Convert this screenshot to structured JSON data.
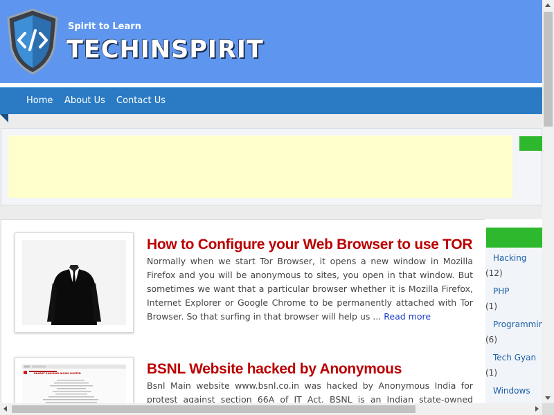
{
  "header": {
    "tagline": "Spirit to Learn",
    "brand": "TECHINSPIRIT",
    "logo_icon": "code-shield-icon",
    "bg_color": "#5e96ef"
  },
  "nav": {
    "items": [
      {
        "label": "Home"
      },
      {
        "label": "About Us"
      },
      {
        "label": "Contact Us"
      }
    ],
    "bg_color": "#2b7bc4"
  },
  "posts": [
    {
      "title": "How to Configure your Web Browser to use TOR",
      "excerpt": "Normally when we start Tor Browser, it opens a new window in Mozilla Firefox and you will be anonymous to sites, you open in that window. But sometimes we want that a particular browser whether it is Mozilla Firefox, Internet Explorer or Google Chrome to be permanently attached with Tor Browser. So that surfing in that browser will help us ...",
      "read_more": "Read more",
      "thumb_icon": "anonymous-suit-icon"
    },
    {
      "title": "BSNL Website hacked by Anonymous",
      "excerpt": "Bsnl Main website www.bsnl.co.in was hacked by Anonymous India for protest against section 66A of IT Act. BSNL is an Indian state-owned telecommunications",
      "thumb_icon": "webpage-screenshot-icon",
      "thumb_caption": "BHARAT SANCHAR NIGAM LIMITED"
    }
  ],
  "sidebar": {
    "categories": [
      {
        "name": "Hacking",
        "count": "(12)"
      },
      {
        "name": "PHP",
        "count": "(1)"
      },
      {
        "name": "Programming",
        "count": "(6)"
      },
      {
        "name": "Tech Gyan",
        "count": "(1)"
      },
      {
        "name": "Windows",
        "count": ""
      }
    ]
  },
  "colors": {
    "title_red": "#bb0000",
    "link_blue": "#1a3fc4",
    "widget_green": "#2eb82e",
    "ad_yellow": "#ffffcc"
  }
}
